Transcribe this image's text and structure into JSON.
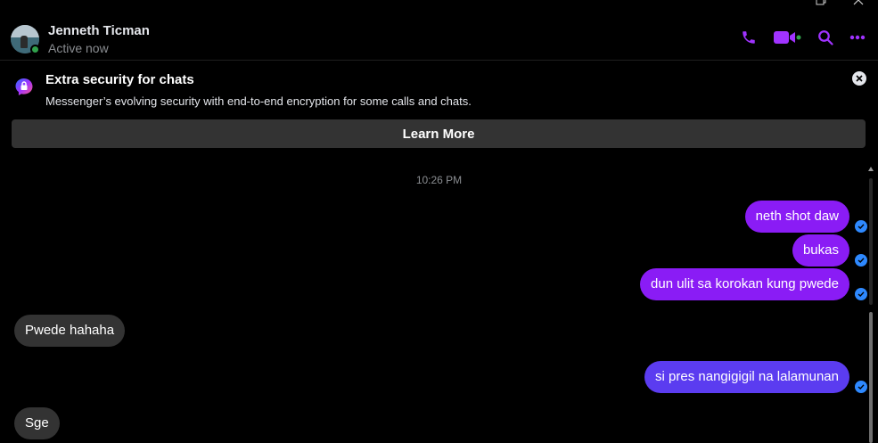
{
  "header": {
    "contact_name": "Jenneth Ticman",
    "status": "Active now",
    "actions": [
      "phone-icon",
      "video-icon",
      "search-icon",
      "more-icon"
    ],
    "accent_color": "#a033ff",
    "presence_color": "#31a24c"
  },
  "banner": {
    "title": "Extra security for chats",
    "text": "Messenger’s evolving security with end-to-end encryption for some calls and chats.",
    "button_label": "Learn More"
  },
  "thread": {
    "timestamp": "10:26 PM",
    "messages": [
      {
        "from": "me",
        "text": "neth shot daw"
      },
      {
        "from": "me",
        "text": "bukas"
      },
      {
        "from": "me",
        "text": "dun ulit sa korokan kung pwede"
      },
      {
        "from": "them",
        "text": "Pwede hahaha"
      },
      {
        "from": "me",
        "text": "si pres nangigigil na lalamunan"
      },
      {
        "from": "them",
        "text": "Sge"
      }
    ],
    "outgoing_color": "#8a1cf5",
    "outgoing_color_2": "#5b3cf0",
    "incoming_color": "#333333",
    "read_receipt_color": "#2e89ff"
  }
}
